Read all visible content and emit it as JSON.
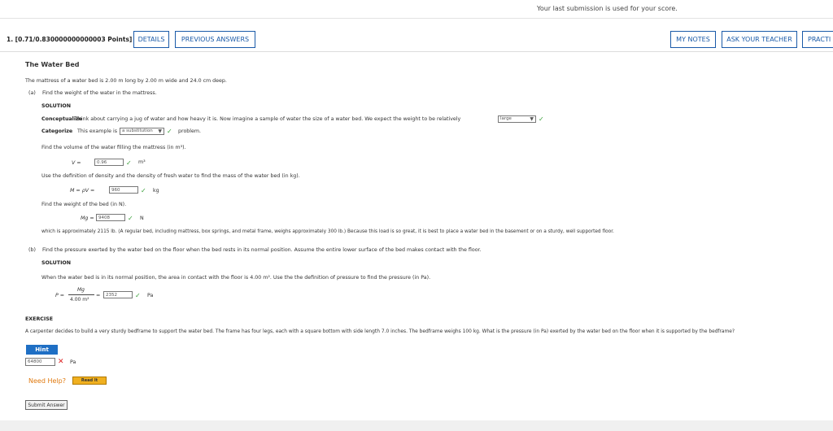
{
  "header": {
    "submission_note": "Your last submission is used for your score."
  },
  "question": {
    "number_points": "1.  [0.71/0.830000000000003 Points]",
    "buttons": {
      "details": "DETAILS",
      "previous_answers": "PREVIOUS ANSWERS",
      "my_notes": "MY NOTES",
      "ask_teacher": "ASK YOUR TEACHER",
      "practice": "PRACTI"
    },
    "title": "The Water Bed",
    "intro": "The mattress of a water bed is 2.00 m long by 2.00 m wide and 24.0 cm deep.",
    "part_a": {
      "label": "(a)",
      "prompt": "Find the weight of the water in the mattress.",
      "solution_label": "SOLUTION",
      "conceptualize_label": "Conceptualize",
      "conceptualize_text": "Think about carrying a jug of water and how heavy it is. Now imagine a sample of water the size of a water bed. We expect the weight to be relatively",
      "conceptualize_select": "large",
      "categorize_label": "Categorize",
      "categorize_text": "This example is",
      "categorize_select": "a substitution",
      "categorize_after": "problem.",
      "volume_prompt": "Find the volume of the water filling the mattress (in m³).",
      "volume_lhs": "V =",
      "volume_value": "0.96",
      "volume_unit": "m³",
      "mass_prompt": "Use the definition of density and the density of fresh water to find the mass of the water bed (in kg).",
      "mass_lhs": "M = ρV =",
      "mass_value": "960",
      "mass_unit": "kg",
      "weight_prompt": "Find the weight of the bed (in N).",
      "weight_lhs": "Mg =",
      "weight_value": "9408",
      "weight_unit": "N",
      "weight_note": "which is approximately 2115 lb. (A regular bed, including mattress, box springs, and metal frame, weighs approximately 300 lb.) Because this load is so great, it is best to place a water bed in the basement or on a sturdy, well supported floor."
    },
    "part_b": {
      "label": "(b)",
      "prompt": "Find the pressure exerted by the water bed on the floor when the bed rests in its normal position. Assume the entire lower surface of the bed makes contact with the floor.",
      "solution_label": "SOLUTION",
      "solution_text": "When the water bed is in its normal position, the area in contact with the floor is 4.00 m². Use the the definition of pressure to find the pressure (in Pa).",
      "pressure_lhs": "P =",
      "frac_num": "Mg",
      "frac_den": "4.00 m²",
      "equals": "=",
      "pressure_value": "2352",
      "pressure_unit": "Pa"
    },
    "exercise": {
      "label": "EXERCISE",
      "text": "A carpenter decides to build a very sturdy bedframe to support the water bed. The frame has four legs, each with a square bottom with side length 7.0 inches. The bedframe weighs 100 kg. What is the pressure (in Pa) exerted by the water bed on the floor when it is supported by the bedframe?",
      "hint_label": "Hint",
      "answer_value": "64800",
      "answer_unit": "Pa",
      "need_help": "Need Help?",
      "read_it": "Read It",
      "submit": "Submit Answer"
    }
  }
}
